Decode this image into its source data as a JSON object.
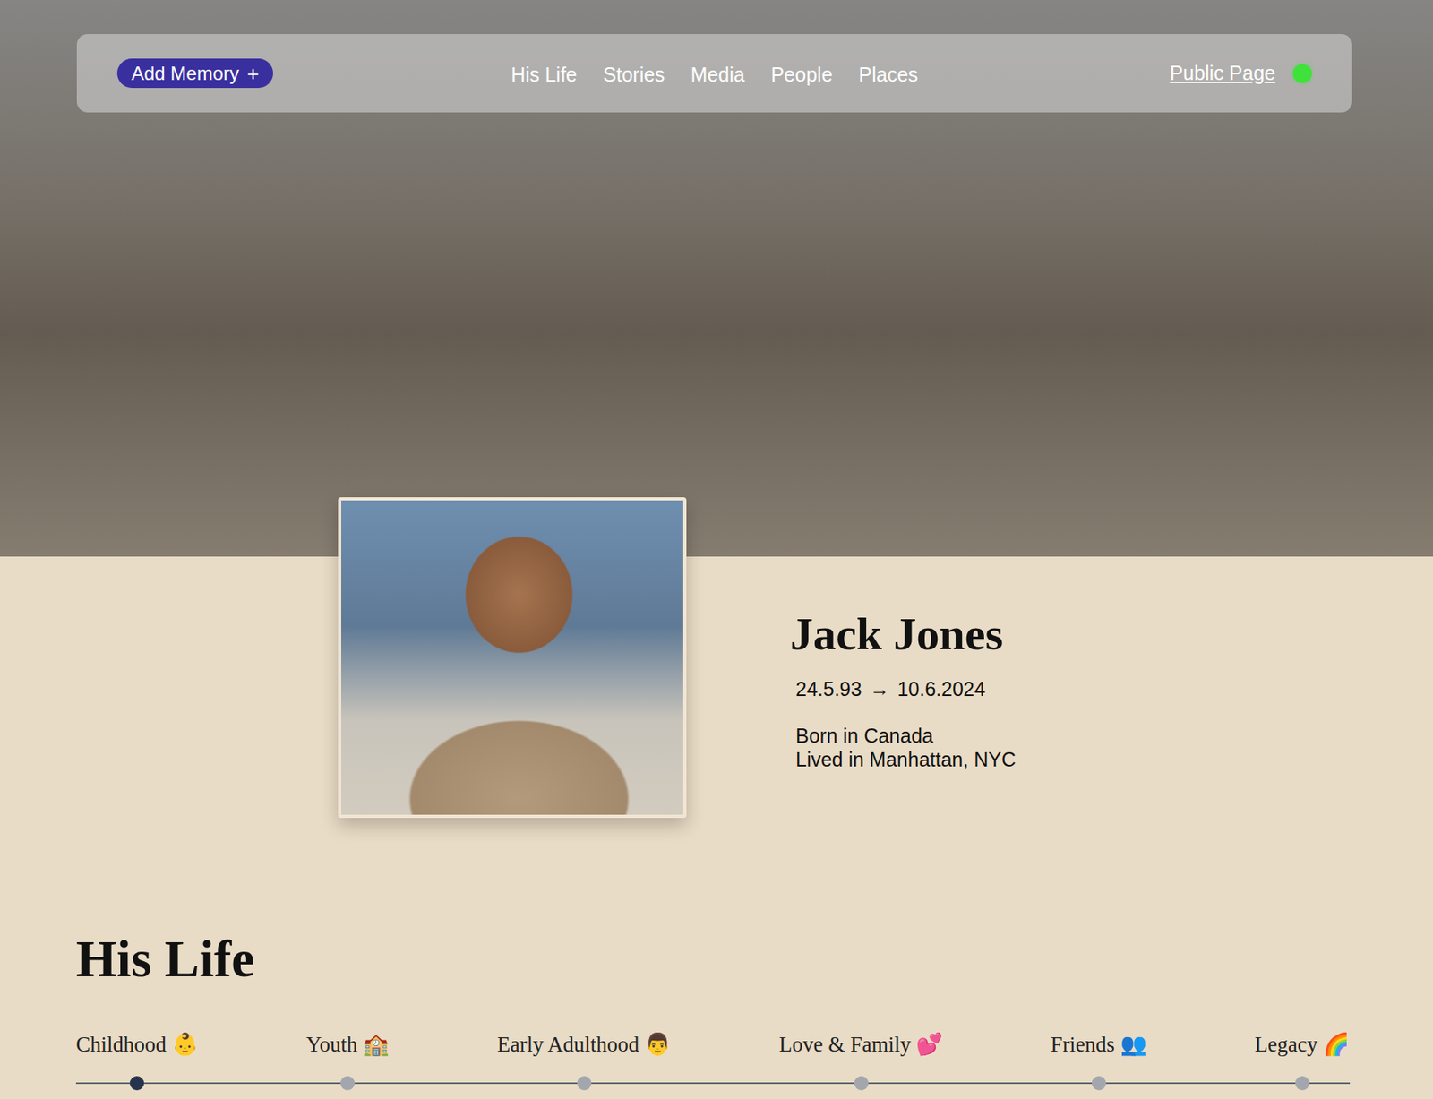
{
  "nav": {
    "add_button": {
      "label": "Add Memory",
      "icon": "+"
    },
    "links": [
      {
        "label": "His Life",
        "selected": false
      },
      {
        "label": "Stories",
        "selected": false
      },
      {
        "label": "Media",
        "selected": false
      },
      {
        "label": "People",
        "selected": false
      },
      {
        "label": "Places",
        "selected": false
      }
    ],
    "public_page": {
      "label": "Public Page",
      "online": true
    }
  },
  "profile": {
    "name": "Jack Jones",
    "dates": {
      "born": "24.5.93",
      "arrow": "→",
      "died": "10.6.2024"
    },
    "details": [
      "Born in Canada",
      "Lived in Manhattan, NYC"
    ]
  },
  "section": {
    "title": "His Life"
  },
  "timeline": [
    {
      "label": "Childhood 👶",
      "selected": true
    },
    {
      "label": "Youth 🏫",
      "selected": false
    },
    {
      "label": "Early Adulthood 👨",
      "selected": false
    },
    {
      "label": "Love & Family 💕",
      "selected": false
    },
    {
      "label": "Friends 👥",
      "selected": false
    },
    {
      "label": "Legacy 🌈",
      "selected": false
    }
  ]
}
